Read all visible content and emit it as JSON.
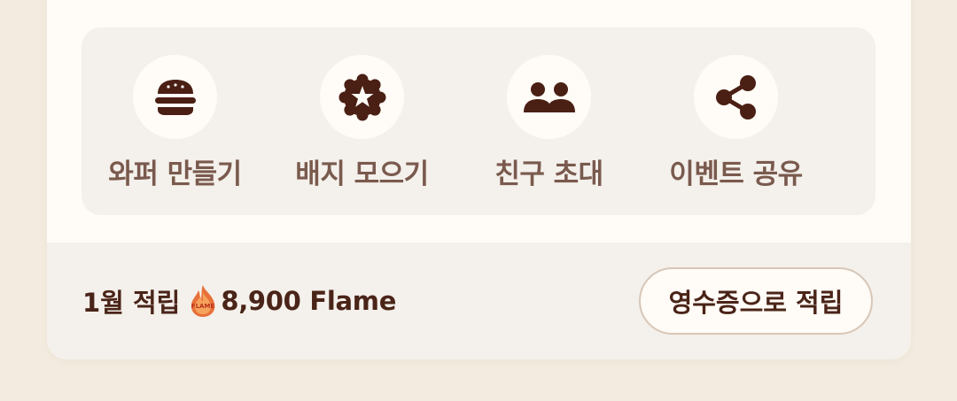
{
  "actions": [
    {
      "label": "와퍼 만들기",
      "icon": "burger-icon"
    },
    {
      "label": "배지 모으기",
      "icon": "badge-star-icon"
    },
    {
      "label": "친구 초대",
      "icon": "friends-icon"
    },
    {
      "label": "이벤트 공유",
      "icon": "share-icon"
    }
  ],
  "footer": {
    "month_label": "1월 적립",
    "flame_value": "8,900 Flame",
    "flame_icon": "flame-icon",
    "flame_icon_text": "FLAME",
    "receipt_button": "영수증으로 적립"
  },
  "colors": {
    "icon": "#4a1f14",
    "label": "#7a5a4e",
    "background": "#f3ebdf",
    "card": "#fffbf6",
    "panel": "#f4f0eb",
    "flame": "#e8703a"
  }
}
